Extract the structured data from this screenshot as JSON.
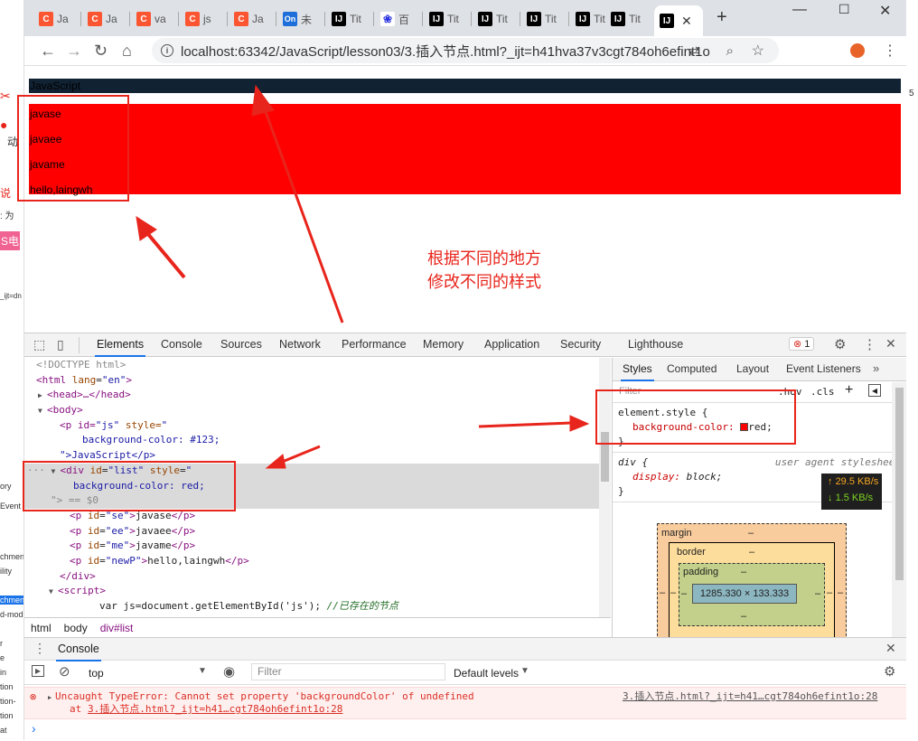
{
  "browser": {
    "tabs": [
      {
        "favicon": "C",
        "label": "Ja"
      },
      {
        "favicon": "C",
        "label": "Ja"
      },
      {
        "favicon": "C",
        "label": "va"
      },
      {
        "favicon": "C",
        "label": "js"
      },
      {
        "favicon": "C",
        "label": "Ja"
      },
      {
        "favicon": "On",
        "label": "未"
      },
      {
        "favicon": "IJ",
        "label": "Tit"
      },
      {
        "favicon": "百",
        "label": "百"
      },
      {
        "favicon": "IJ",
        "label": "Tit"
      },
      {
        "favicon": "IJ",
        "label": "Tit"
      },
      {
        "favicon": "IJ",
        "label": "Tit"
      },
      {
        "favicon": "IJ",
        "label": "Tit"
      },
      {
        "favicon": "IJ",
        "label": "Tit"
      }
    ],
    "active_tab_favicon": "IJ",
    "url": "localhost:63342/JavaScript/lesson03/3.插入节点.html?_ijt=h41hva37v3cgt784oh6efint1o"
  },
  "page": {
    "p_js": "JavaScript",
    "list_items": [
      "javase",
      "javaee",
      "javame",
      "hello,laingwh"
    ],
    "annotation": [
      "根据不同的地方",
      "修改不同的样式"
    ]
  },
  "devtools": {
    "tabs": [
      "Elements",
      "Console",
      "Sources",
      "Network",
      "Performance",
      "Memory",
      "Application",
      "Security",
      "Lighthouse"
    ],
    "active_tab": "Elements",
    "error_count": "1",
    "dom": {
      "doctype": "<!DOCTYPE html>",
      "html_open": "html",
      "lang_attr": "lang",
      "lang_val": "\"en\"",
      "head": "head",
      "head_ellipsis": "…</head>",
      "body": "body",
      "p_js_line1_pre": "<p id=",
      "p_js_id": "\"js\"",
      "p_js_style": " style=",
      "p_js_style_quote": "\"",
      "p_js_style_value": "background-color: #123;",
      "p_js_close": "\">JavaScript</p>",
      "div_id": "\"list\"",
      "div_style_value": "background-color: red;",
      "div_close": "\"> == $0",
      "children": [
        {
          "id": "\"se\"",
          "text": "javase"
        },
        {
          "id": "\"ee\"",
          "text": "javaee"
        },
        {
          "id": "\"me\"",
          "text": "javame"
        },
        {
          "id": "\"newP\"",
          "text": "hello,laingwh"
        }
      ],
      "div_end": "</div>",
      "script": "script",
      "script_code": "var js=document.getElementById('js');",
      "script_comment": "//已存在的节点"
    },
    "breadcrumb": [
      "html",
      "body",
      "div#list"
    ],
    "styles_tabs": [
      "Styles",
      "Computed",
      "Layout",
      "Event Listeners"
    ],
    "styles": {
      "filter_placeholder": "Filter",
      "hov": ":hov",
      "cls": ".cls",
      "element_style_selector": "element.style {",
      "element_style_prop": "background-color:",
      "element_style_value": "red;",
      "div_selector": "div {",
      "ua_label": "user agent stylesheet",
      "div_prop": "display:",
      "div_value": "block;",
      "close_brace": "}"
    },
    "box_model": {
      "margin": "margin",
      "border": "border",
      "padding": "padding",
      "dash": "–",
      "content": "1285.330 × 133.333"
    },
    "net_speed": {
      "up": "29.5 KB/s",
      "down": "1.5 KB/s"
    },
    "console": {
      "title": "Console",
      "context": "top",
      "filter_placeholder": "Filter",
      "levels": "Default levels",
      "error_message": "Uncaught TypeError: Cannot set property 'backgroundColor' of undefined",
      "error_at": "at",
      "error_link": "3.插入节点.html?_ijt=h41…cgt784oh6efint1o:28",
      "error_source": "3.插入节点.html?_ijt=h41…cgt784oh6efint1o:28",
      "prompt": "›"
    }
  },
  "left_strip": [
    "动",
    "说",
    ": 为",
    "S电",
    "_ijt=dn",
    "ory",
    "Event",
    "chmen",
    "ility",
    "chmen",
    "d-mod",
    "r",
    "e",
    "in",
    "tion",
    "tion-",
    "tion",
    "at"
  ],
  "right_strip": "5",
  "colors": {
    "p_js_bg": "#112233",
    "list_bg": "#ff0000",
    "annotation": "#e8251c"
  }
}
